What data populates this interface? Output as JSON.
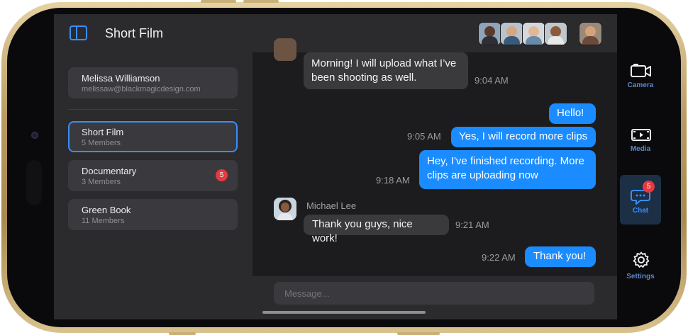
{
  "header": {
    "title": "Short Film"
  },
  "account": {
    "name": "Melissa Williamson",
    "email": "melissaw@blackmagicdesign.com"
  },
  "projects": [
    {
      "name": "Short Film",
      "members": "5 Members",
      "badge": ""
    },
    {
      "name": "Documentary",
      "members": "3 Members",
      "badge": "5"
    },
    {
      "name": "Green Book",
      "members": "11 Members",
      "badge": ""
    }
  ],
  "messages": [
    {
      "line1": "Morning! I will upload what I’ve",
      "line2": "been shooting as well.",
      "time": "9:04 AM"
    },
    {
      "text": "Hello!"
    },
    {
      "text": "Yes, I will record more clips",
      "time": "9:05 AM"
    },
    {
      "line1": "Hey, I've finished recording. More",
      "line2": "clips are uploading now",
      "time": "9:18 AM"
    },
    {
      "sender": "Michael Lee",
      "text": "Thank you guys, nice work!",
      "time": "9:21 AM"
    },
    {
      "text": "Thank you!",
      "time": "9:22 AM"
    }
  ],
  "composer": {
    "placeholder": "Message..."
  },
  "tabs": [
    {
      "label": "Camera",
      "icon": "camera-icon"
    },
    {
      "label": "Media",
      "icon": "film-icon"
    },
    {
      "label": "Chat",
      "icon": "chat-bubble-icon",
      "badge": "5",
      "active": true
    },
    {
      "label": "Settings",
      "icon": "gear-icon"
    }
  ],
  "colors": {
    "accent": "#1a8cff",
    "badge": "#e5393f",
    "surface": "#2b2b2e",
    "background": "#1c1c1e"
  }
}
